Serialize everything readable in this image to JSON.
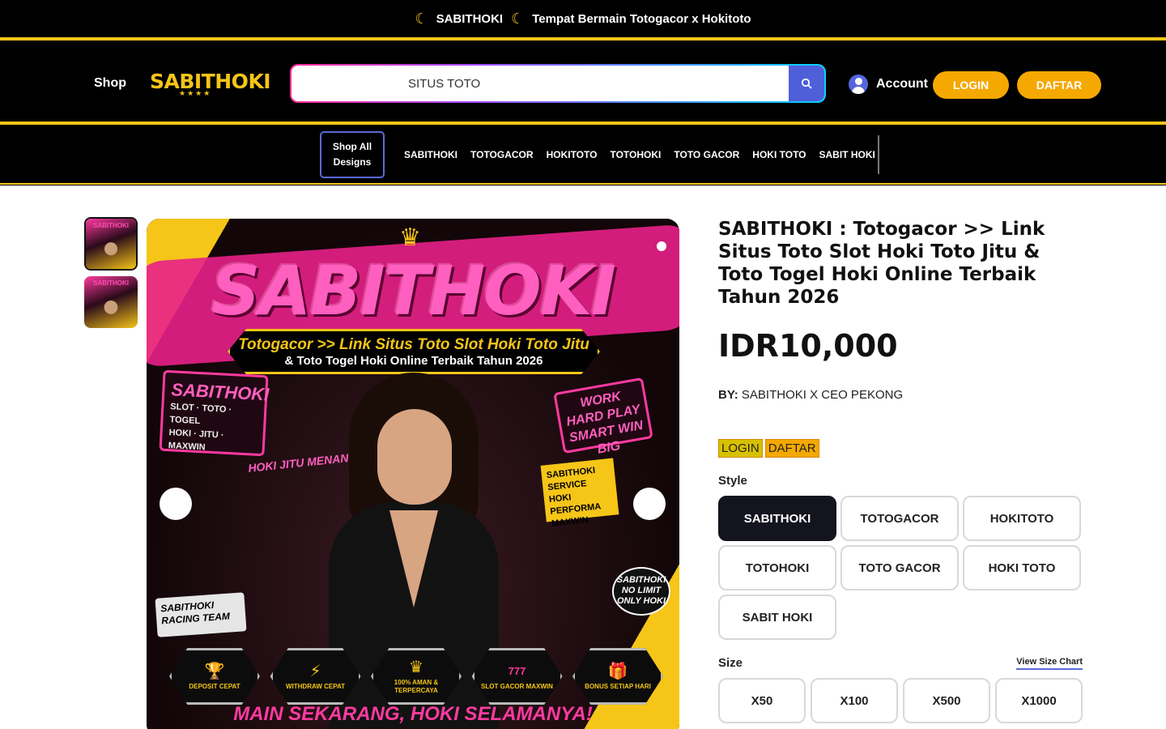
{
  "announcement": {
    "brand": "SABITHOKI",
    "tagline": "Tempat Bermain Totogacor x Hokitoto",
    "moon_icon": "☾"
  },
  "header": {
    "shop_label": "Shop",
    "logo_text": "SABITHOKI",
    "search_value": "SITUS TOTO",
    "account_label": "Account",
    "login_label": "LOGIN",
    "daftar_label": "DAFTAR"
  },
  "nav": {
    "shop_all": "Shop All Designs",
    "items": [
      "SABITHOKI",
      "TOTOGACOR",
      "HOKITOTO",
      "TOTOHOKI",
      "TOTO GACOR",
      "HOKI TOTO",
      "SABIT HOKI"
    ]
  },
  "hero": {
    "title": "SABITHOKI",
    "banner_line1": "Totogacor >> Link Situs Toto Slot Hoki Toto Jitu",
    "banner_line2": "& Toto Togel Hoki Online Terbaik Tahun 2026",
    "left_sign_title": "SABITHOKI",
    "left_sign_line1": "SLOT · TOTO · TOGEL",
    "left_sign_line2": "HOKI · JITU · MAXWIN",
    "note": "HOKI JITU MENANG TERUS!",
    "right_sign": "WORK HARD PLAY SMART WIN BIG",
    "yellow_sign": "SABITHOKI SERVICE HOKI PERFORMA MAXWIN",
    "racing": "SABITHOKI RACING TEAM",
    "nolimit": "SABITHOKI NO LIMIT ONLY HOKI",
    "badges": [
      {
        "icon": "trophy-icon",
        "glyph": "🏆",
        "label": "DEPOSIT CEPAT"
      },
      {
        "icon": "lightning-icon",
        "glyph": "⚡",
        "label": "WITHDRAW CEPAT"
      },
      {
        "icon": "crown-icon",
        "glyph": "♛",
        "label": "100% AMAN & TERPERCAYA"
      },
      {
        "icon": "slot-icon",
        "glyph": "777",
        "label": "SLOT GACOR MAXWIN"
      },
      {
        "icon": "gift-icon",
        "glyph": "🎁",
        "label": "BONUS SETIAP HARI"
      }
    ],
    "footer": "MAIN SEKARANG, HOKI SELAMANYA!"
  },
  "product": {
    "title": "SABITHOKI : Totogacor >> Link Situs Toto Slot Hoki Toto Jitu & Toto Togel Hoki Online Terbaik Tahun 2026",
    "price": "IDR10,000",
    "by_label": "BY:",
    "by_value": "SABITHOKI X CEO PEKONG",
    "tag_login": "LOGIN",
    "tag_daftar": "DAFTAR",
    "style_label": "Style",
    "styles": [
      "SABITHOKI",
      "TOTOGACOR",
      "HOKITOTO",
      "TOTOHOKI",
      "TOTO GACOR",
      "HOKI TOTO",
      "SABIT HOKI"
    ],
    "selected_style": "SABITHOKI",
    "size_label": "Size",
    "size_chart": "View Size Chart",
    "sizes": [
      "X50",
      "X100",
      "X500",
      "X1000"
    ]
  },
  "colors": {
    "gold": "#f5c518",
    "orange": "#f5a800",
    "accent_blue": "#4f5fd9",
    "pink": "#ff3aa0"
  }
}
